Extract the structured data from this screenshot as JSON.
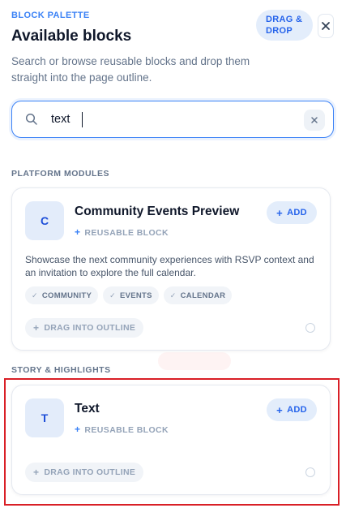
{
  "header": {
    "eyebrow": "BLOCK PALETTE",
    "title": "Available blocks",
    "description": "Search or browse reusable blocks and drop them straight into the page outline.",
    "mode_pill_line1": "DRAG &",
    "mode_pill_line2": "DROP",
    "close_icon": "close-icon"
  },
  "search": {
    "value": "text",
    "search_icon": "search-icon",
    "clear_icon": "clear-icon"
  },
  "sections": [
    {
      "label": "PLATFORM MODULES",
      "cards": [
        {
          "avatar": "C",
          "title": "Community Events Preview",
          "subtitle": "REUSABLE BLOCK",
          "add_label": "ADD",
          "description": "Showcase the next community experiences with RSVP context and an invitation to explore the full calendar.",
          "tags": [
            "COMMUNITY",
            "EVENTS",
            "CALENDAR"
          ],
          "drag_label": "DRAG INTO OUTLINE"
        }
      ]
    },
    {
      "label": "STORY & HIGHLIGHTS",
      "cards": [
        {
          "avatar": "T",
          "title": "Text",
          "subtitle": "REUSABLE BLOCK",
          "add_label": "ADD",
          "drag_label": "DRAG INTO OUTLINE"
        }
      ]
    }
  ],
  "colors": {
    "accent": "#2563eb",
    "accent_soft": "#e3edfb",
    "highlight_border": "#d91f26"
  }
}
